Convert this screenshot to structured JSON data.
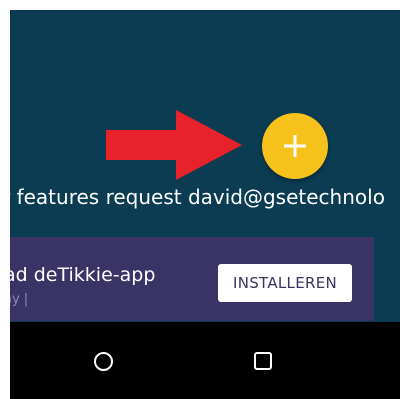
{
  "colors": {
    "app_background": "#0b3c52",
    "fab": "#f6c21b",
    "arrow": "#e8222a",
    "ad_background": "#3a3466",
    "nav_bar": "#000000"
  },
  "fab": {
    "icon": "plus-icon"
  },
  "feature_request_text": "r features request david@gsetechnolo",
  "ad": {
    "title": "ad deTikkie-app",
    "subtitle": "ay  |",
    "install_label": "INSTALLEREN"
  },
  "nav": {
    "home_icon": "home-circle-icon",
    "recents_icon": "recents-square-icon"
  }
}
